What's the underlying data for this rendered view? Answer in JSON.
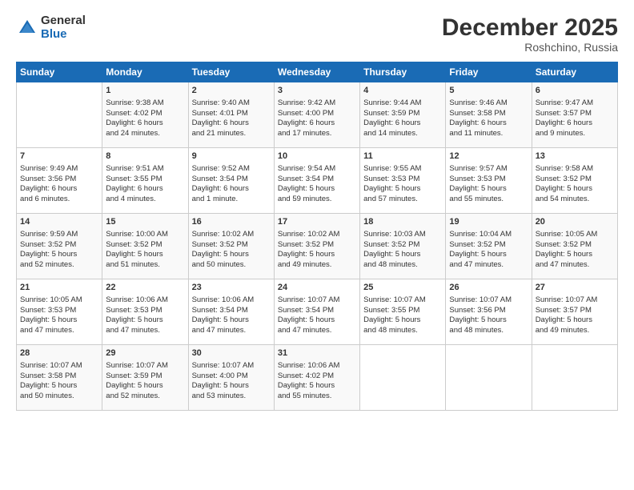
{
  "logo": {
    "general": "General",
    "blue": "Blue"
  },
  "title": "December 2025",
  "location": "Roshchino, Russia",
  "headers": [
    "Sunday",
    "Monday",
    "Tuesday",
    "Wednesday",
    "Thursday",
    "Friday",
    "Saturday"
  ],
  "weeks": [
    [
      {
        "day": "",
        "info": ""
      },
      {
        "day": "1",
        "info": "Sunrise: 9:38 AM\nSunset: 4:02 PM\nDaylight: 6 hours\nand 24 minutes."
      },
      {
        "day": "2",
        "info": "Sunrise: 9:40 AM\nSunset: 4:01 PM\nDaylight: 6 hours\nand 21 minutes."
      },
      {
        "day": "3",
        "info": "Sunrise: 9:42 AM\nSunset: 4:00 PM\nDaylight: 6 hours\nand 17 minutes."
      },
      {
        "day": "4",
        "info": "Sunrise: 9:44 AM\nSunset: 3:59 PM\nDaylight: 6 hours\nand 14 minutes."
      },
      {
        "day": "5",
        "info": "Sunrise: 9:46 AM\nSunset: 3:58 PM\nDaylight: 6 hours\nand 11 minutes."
      },
      {
        "day": "6",
        "info": "Sunrise: 9:47 AM\nSunset: 3:57 PM\nDaylight: 6 hours\nand 9 minutes."
      }
    ],
    [
      {
        "day": "7",
        "info": "Sunrise: 9:49 AM\nSunset: 3:56 PM\nDaylight: 6 hours\nand 6 minutes."
      },
      {
        "day": "8",
        "info": "Sunrise: 9:51 AM\nSunset: 3:55 PM\nDaylight: 6 hours\nand 4 minutes."
      },
      {
        "day": "9",
        "info": "Sunrise: 9:52 AM\nSunset: 3:54 PM\nDaylight: 6 hours\nand 1 minute."
      },
      {
        "day": "10",
        "info": "Sunrise: 9:54 AM\nSunset: 3:54 PM\nDaylight: 5 hours\nand 59 minutes."
      },
      {
        "day": "11",
        "info": "Sunrise: 9:55 AM\nSunset: 3:53 PM\nDaylight: 5 hours\nand 57 minutes."
      },
      {
        "day": "12",
        "info": "Sunrise: 9:57 AM\nSunset: 3:53 PM\nDaylight: 5 hours\nand 55 minutes."
      },
      {
        "day": "13",
        "info": "Sunrise: 9:58 AM\nSunset: 3:52 PM\nDaylight: 5 hours\nand 54 minutes."
      }
    ],
    [
      {
        "day": "14",
        "info": "Sunrise: 9:59 AM\nSunset: 3:52 PM\nDaylight: 5 hours\nand 52 minutes."
      },
      {
        "day": "15",
        "info": "Sunrise: 10:00 AM\nSunset: 3:52 PM\nDaylight: 5 hours\nand 51 minutes."
      },
      {
        "day": "16",
        "info": "Sunrise: 10:02 AM\nSunset: 3:52 PM\nDaylight: 5 hours\nand 50 minutes."
      },
      {
        "day": "17",
        "info": "Sunrise: 10:02 AM\nSunset: 3:52 PM\nDaylight: 5 hours\nand 49 minutes."
      },
      {
        "day": "18",
        "info": "Sunrise: 10:03 AM\nSunset: 3:52 PM\nDaylight: 5 hours\nand 48 minutes."
      },
      {
        "day": "19",
        "info": "Sunrise: 10:04 AM\nSunset: 3:52 PM\nDaylight: 5 hours\nand 47 minutes."
      },
      {
        "day": "20",
        "info": "Sunrise: 10:05 AM\nSunset: 3:52 PM\nDaylight: 5 hours\nand 47 minutes."
      }
    ],
    [
      {
        "day": "21",
        "info": "Sunrise: 10:05 AM\nSunset: 3:53 PM\nDaylight: 5 hours\nand 47 minutes."
      },
      {
        "day": "22",
        "info": "Sunrise: 10:06 AM\nSunset: 3:53 PM\nDaylight: 5 hours\nand 47 minutes."
      },
      {
        "day": "23",
        "info": "Sunrise: 10:06 AM\nSunset: 3:54 PM\nDaylight: 5 hours\nand 47 minutes."
      },
      {
        "day": "24",
        "info": "Sunrise: 10:07 AM\nSunset: 3:54 PM\nDaylight: 5 hours\nand 47 minutes."
      },
      {
        "day": "25",
        "info": "Sunrise: 10:07 AM\nSunset: 3:55 PM\nDaylight: 5 hours\nand 48 minutes."
      },
      {
        "day": "26",
        "info": "Sunrise: 10:07 AM\nSunset: 3:56 PM\nDaylight: 5 hours\nand 48 minutes."
      },
      {
        "day": "27",
        "info": "Sunrise: 10:07 AM\nSunset: 3:57 PM\nDaylight: 5 hours\nand 49 minutes."
      }
    ],
    [
      {
        "day": "28",
        "info": "Sunrise: 10:07 AM\nSunset: 3:58 PM\nDaylight: 5 hours\nand 50 minutes."
      },
      {
        "day": "29",
        "info": "Sunrise: 10:07 AM\nSunset: 3:59 PM\nDaylight: 5 hours\nand 52 minutes."
      },
      {
        "day": "30",
        "info": "Sunrise: 10:07 AM\nSunset: 4:00 PM\nDaylight: 5 hours\nand 53 minutes."
      },
      {
        "day": "31",
        "info": "Sunrise: 10:06 AM\nSunset: 4:02 PM\nDaylight: 5 hours\nand 55 minutes."
      },
      {
        "day": "",
        "info": ""
      },
      {
        "day": "",
        "info": ""
      },
      {
        "day": "",
        "info": ""
      }
    ]
  ]
}
